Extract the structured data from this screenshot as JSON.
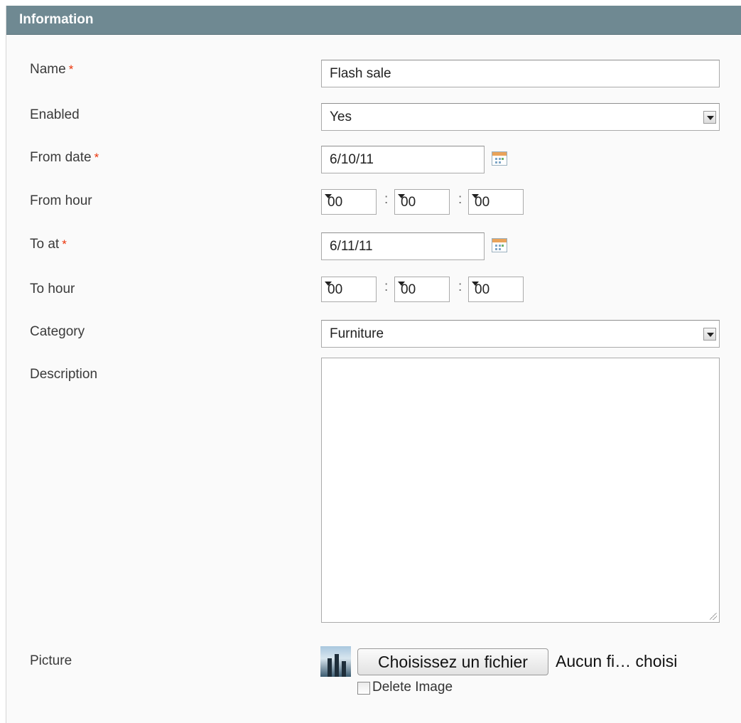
{
  "header": {
    "title": "Information"
  },
  "required_marker": "*",
  "accent_colors": {
    "header_bg": "#6f8992",
    "required": "#eb340a"
  },
  "fields": {
    "name": {
      "label": "Name",
      "value": "Flash sale"
    },
    "enabled": {
      "label": "Enabled",
      "value": "Yes"
    },
    "from_date": {
      "label": "From date",
      "value": "6/10/11",
      "icon": "calendar-icon"
    },
    "from_hour": {
      "label": "From hour",
      "hours": "00",
      "minutes": "00",
      "seconds": "00",
      "separator": ":"
    },
    "to_at": {
      "label": "To at",
      "value": "6/11/11",
      "icon": "calendar-icon"
    },
    "to_hour": {
      "label": "To hour",
      "hours": "00",
      "minutes": "00",
      "seconds": "00",
      "separator": ":"
    },
    "category": {
      "label": "Category",
      "value": "Furniture"
    },
    "description": {
      "label": "Description",
      "value": ""
    },
    "picture": {
      "label": "Picture",
      "choose_button": "Choisissez un fichier",
      "file_status": "Aucun fi… choisi",
      "delete_label": "Delete Image",
      "delete_checked": false
    }
  }
}
